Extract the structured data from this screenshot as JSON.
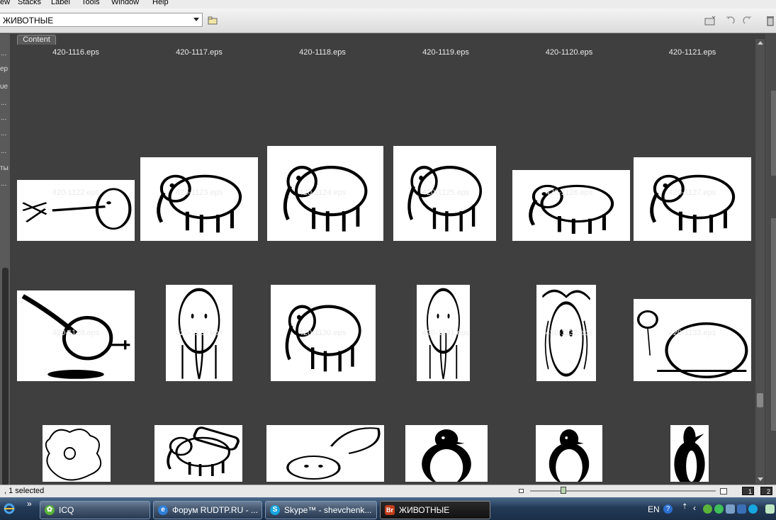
{
  "menu": [
    "ew",
    "Stacks",
    "Label",
    "Tools",
    "Window",
    "Help"
  ],
  "path_bar": {
    "folder": "ЖИВОТНЫЕ"
  },
  "left_panel_fragments": [
    "ep",
    "ue",
    "ты"
  ],
  "content_tab": "Content",
  "thumbnails": [
    {
      "name": "420-1116.eps",
      "art": "elephant-silhouette-outline"
    },
    {
      "name": "420-1117.eps",
      "art": "elephant-white-on-black"
    },
    {
      "name": "420-1118.eps",
      "art": "elephant-black-silhouette"
    },
    {
      "name": "420-1119.eps",
      "art": "elephant-legs"
    },
    {
      "name": "420-1120.eps",
      "art": "elephant-line-legs"
    },
    {
      "name": "420-1121.eps",
      "art": "elephant-lying"
    },
    {
      "name": "420-1122.eps",
      "art": "elephant-sneezing"
    },
    {
      "name": "420-1123.eps",
      "art": "mammoth-curled"
    },
    {
      "name": "420-1124.eps",
      "art": "elephant-standing"
    },
    {
      "name": "420-1125.eps",
      "art": "elephant-sad"
    },
    {
      "name": "420-1126.eps",
      "art": "elephant-lying-down"
    },
    {
      "name": "420-1127.eps",
      "art": "elephant-cartoon"
    },
    {
      "name": "420-1128.eps",
      "art": "elephant-jumping"
    },
    {
      "name": "420-1129.eps",
      "art": "mammoth-front"
    },
    {
      "name": "420-1130.eps",
      "art": "elephant-smiling"
    },
    {
      "name": "420-1131.eps",
      "art": "elephant-front-thin"
    },
    {
      "name": "420-1132.eps",
      "art": "elephant-crowd"
    },
    {
      "name": "420-1133.eps",
      "art": "elephant-balloon"
    },
    {
      "name": "",
      "art": "elephant-smoke"
    },
    {
      "name": "",
      "art": "elephant-log"
    },
    {
      "name": "",
      "art": "elephant-flying"
    },
    {
      "name": "",
      "art": "penguin"
    },
    {
      "name": "",
      "art": "penguin"
    },
    {
      "name": "",
      "art": "penguin-black"
    }
  ],
  "status": {
    "selection": ", 1 selected",
    "zoom_fraction": 0.18,
    "view_buttons": [
      "1",
      "2"
    ]
  },
  "taskbar": {
    "tasks": [
      {
        "label": "ICQ",
        "icon": "icq-flower-icon"
      },
      {
        "label": "Форум RUDTP.RU - ...",
        "icon": "ie-icon"
      },
      {
        "label": "Skype™ - shevchenk...",
        "icon": "skype-icon"
      },
      {
        "label": "ЖИВОТНЫЕ",
        "icon": "bridge-icon",
        "icon_text": "Br"
      }
    ],
    "lang": "EN"
  },
  "colors": {
    "panel_bg": "#3f3f3f",
    "taskbar": "#233a57",
    "bridge_icon": "#c23d1a"
  }
}
